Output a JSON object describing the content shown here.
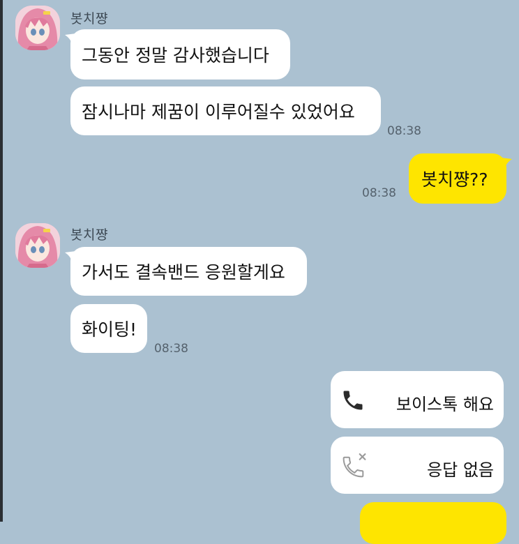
{
  "chat": {
    "sender_name": "봇치쨩",
    "icons": {
      "avatar": "bocchi-avatar",
      "voicetalk": "phone-icon",
      "missed": "phone-missed-icon"
    },
    "colors": {
      "background": "#abc1d1",
      "incoming_bubble": "#ffffff",
      "outgoing_bubble": "#fee500"
    },
    "group1": {
      "sender": "봇치쨩",
      "messages": [
        "그동안 정말 감사했습니다",
        "잠시나마 제꿈이 이루어질수 있었어요"
      ],
      "time": "08:38"
    },
    "outgoing1": {
      "text": "봇치쨩??",
      "time": "08:38"
    },
    "group2": {
      "sender": "봇치쨩",
      "messages": [
        "가서도 결속밴드 응원할게요",
        "화이팅!"
      ],
      "time": "08:38"
    },
    "call1": {
      "label": "보이스톡 해요"
    },
    "call2": {
      "label": "응답 없음"
    }
  }
}
